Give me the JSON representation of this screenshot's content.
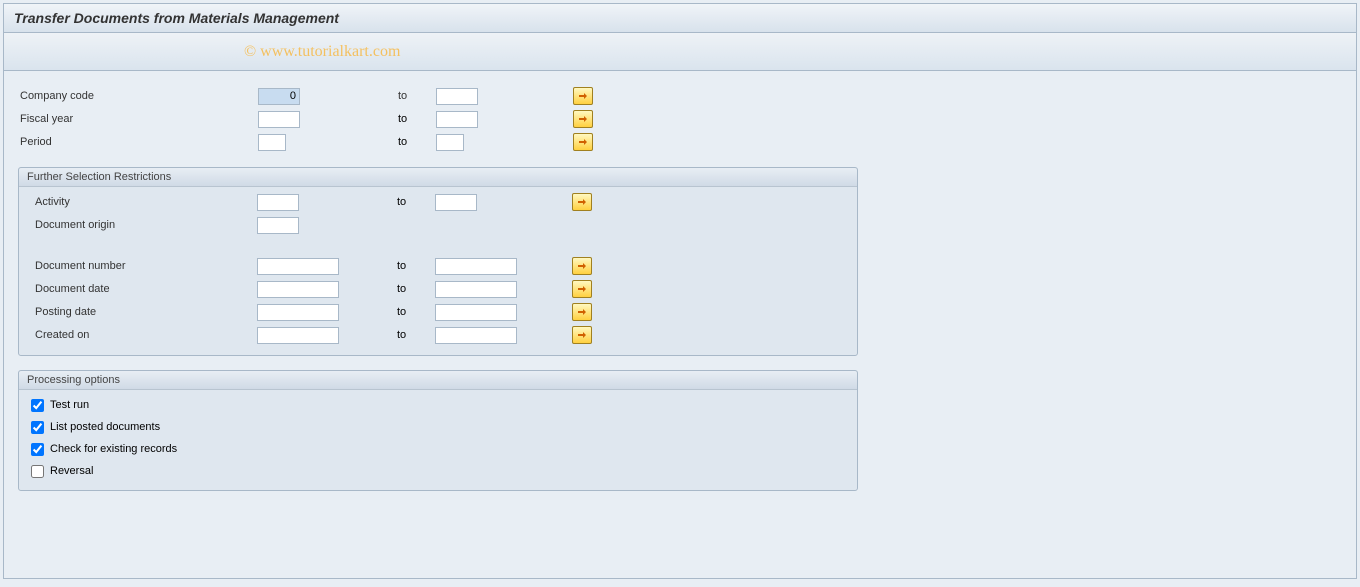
{
  "title": "Transfer Documents from Materials Management",
  "watermark": "© www.tutorialkart.com",
  "top_fields": {
    "company_code": {
      "label": "Company code",
      "from": "0",
      "to_label": "to",
      "to": ""
    },
    "fiscal_year": {
      "label": "Fiscal year",
      "from": "",
      "to_label": "to",
      "to": ""
    },
    "period": {
      "label": "Period",
      "from": "",
      "to_label": "to",
      "to": ""
    }
  },
  "further_section": {
    "header": "Further Selection Restrictions",
    "activity": {
      "label": "Activity",
      "from": "",
      "to_label": "to",
      "to": ""
    },
    "document_origin": {
      "label": "Document origin",
      "from": ""
    },
    "document_number": {
      "label": "Document number",
      "from": "",
      "to_label": "to",
      "to": ""
    },
    "document_date": {
      "label": "Document date",
      "from": "",
      "to_label": "to",
      "to": ""
    },
    "posting_date": {
      "label": "Posting date",
      "from": "",
      "to_label": "to",
      "to": ""
    },
    "created_on": {
      "label": "Created on",
      "from": "",
      "to_label": "to",
      "to": ""
    }
  },
  "processing_section": {
    "header": "Processing options",
    "test_run": {
      "label": "Test run",
      "checked": true
    },
    "list_posted": {
      "label": "List posted documents",
      "checked": true
    },
    "check_existing": {
      "label": "Check for existing records",
      "checked": true
    },
    "reversal": {
      "label": "Reversal",
      "checked": false
    }
  }
}
